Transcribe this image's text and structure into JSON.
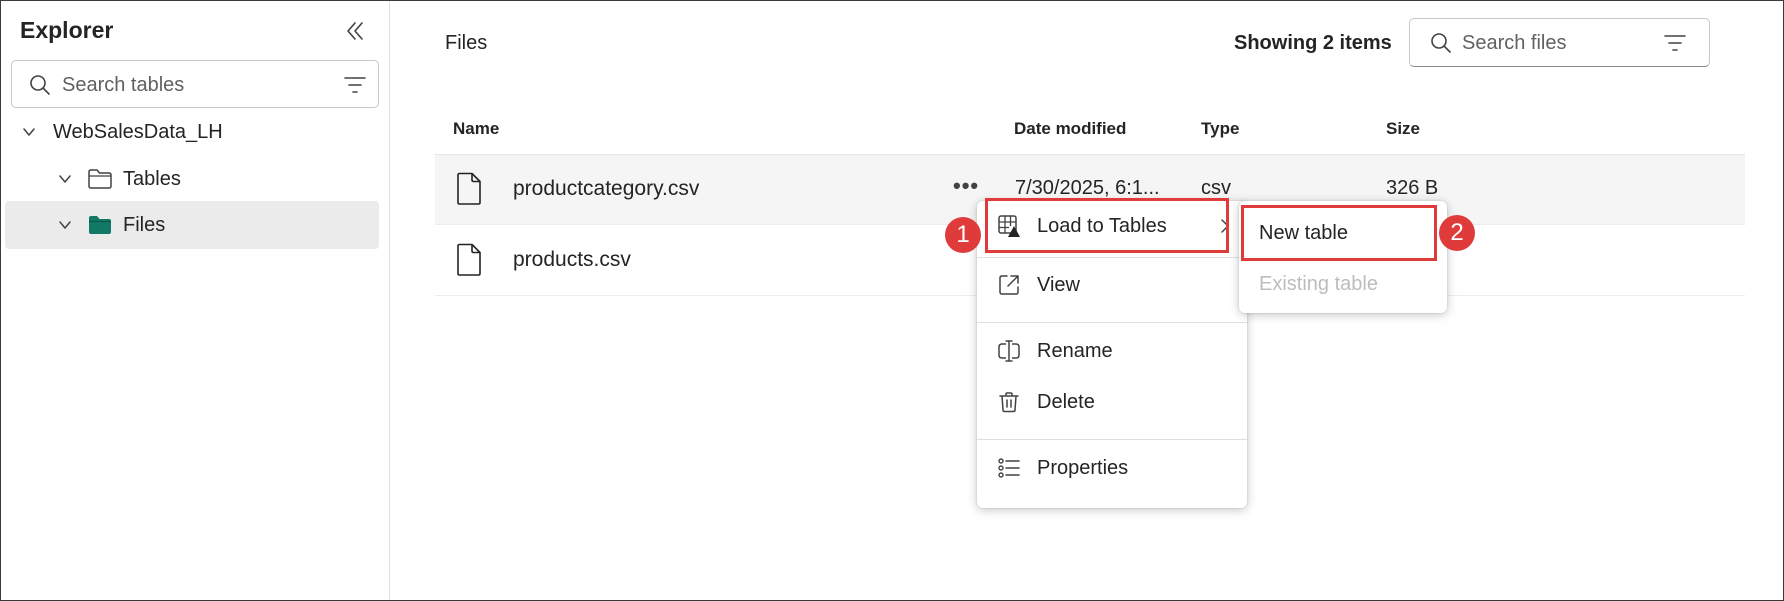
{
  "sidebar": {
    "title": "Explorer",
    "search_placeholder": "Search tables",
    "tree": [
      {
        "label": "WebSalesData_LH",
        "level": 0,
        "expanded": true
      },
      {
        "label": "Tables",
        "level": 1,
        "expanded": false,
        "icon": "folder-outline-icon"
      },
      {
        "label": "Files",
        "level": 1,
        "expanded": true,
        "selected": true,
        "icon": "folder-filled-icon"
      }
    ]
  },
  "main": {
    "title": "Files",
    "item_count": "Showing 2 items",
    "search_placeholder": "Search files",
    "columns": [
      "Name",
      "Date modified",
      "Type",
      "Size"
    ],
    "rows": [
      {
        "name": "productcategory.csv",
        "date": "7/30/2025, 6:1...",
        "type": "csv",
        "size": "326 B"
      },
      {
        "name": "products.csv"
      }
    ]
  },
  "context_menu": {
    "items": [
      {
        "label": "Load to Tables",
        "icon": "table-load-icon",
        "has_submenu": true
      },
      {
        "label": "View",
        "icon": "open-external-icon"
      },
      {
        "label": "Rename",
        "icon": "rename-icon"
      },
      {
        "label": "Delete",
        "icon": "trash-icon"
      },
      {
        "label": "Properties",
        "icon": "properties-list-icon"
      }
    ]
  },
  "submenu": {
    "items": [
      {
        "label": "New table",
        "enabled": true
      },
      {
        "label": "Existing table",
        "enabled": false
      }
    ]
  },
  "callouts": [
    "1",
    "2"
  ],
  "colors": {
    "accent_green": "#117865",
    "callout_red": "#e03b3b",
    "selected_bg": "#ebebeb"
  }
}
